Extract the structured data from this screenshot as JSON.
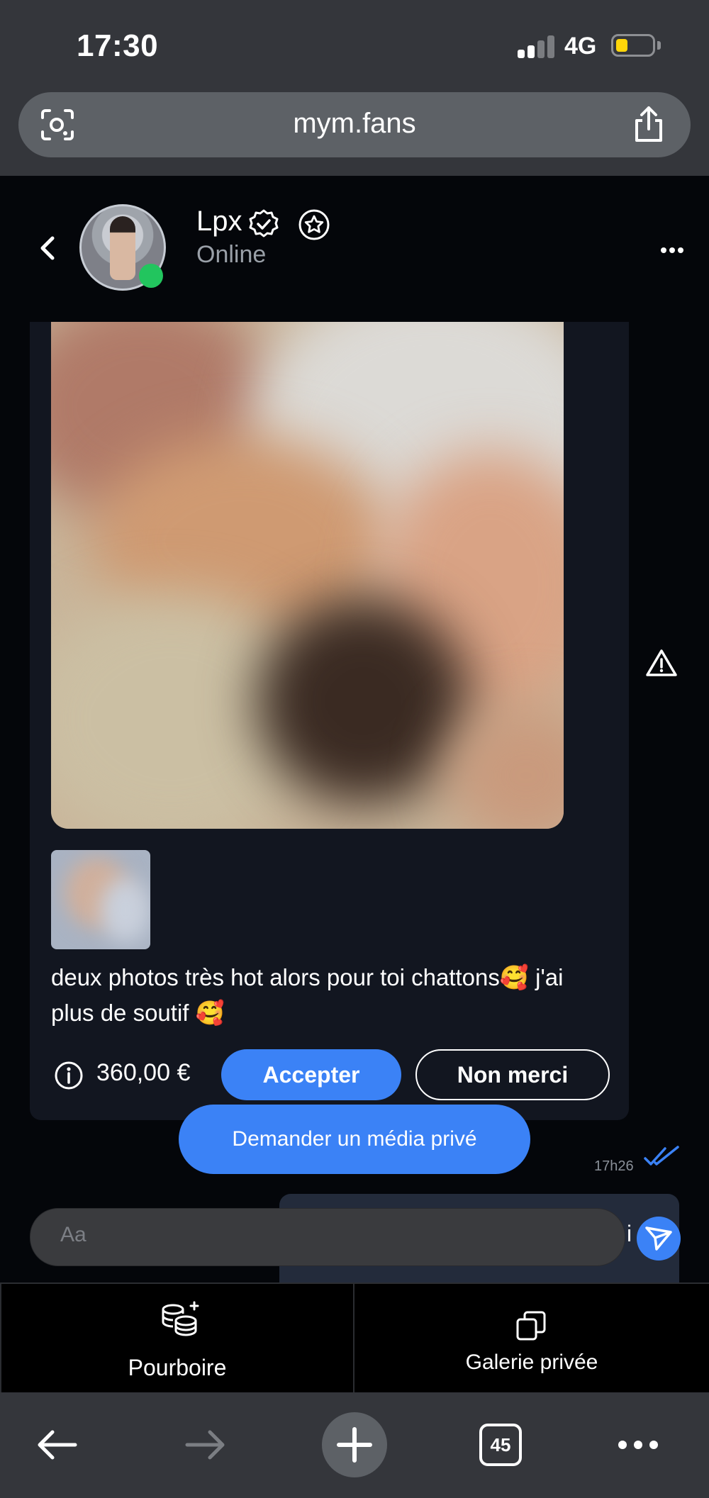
{
  "status_bar": {
    "time": "17:30",
    "network": "4G"
  },
  "browser": {
    "url": "mym.fans",
    "open_tabs": "45"
  },
  "chat_header": {
    "name": "Lpx",
    "status": "Online"
  },
  "offer": {
    "message": "deux photos très hot alors pour toi chattons🥰 j'ai plus de soutif 🥰",
    "price": "360,00 €",
    "accept_label": "Accepter",
    "decline_label": "Non merci"
  },
  "request_media_label": "Demander un média privé",
  "timestamp": "17h26",
  "sent_fragment": "i",
  "composer": {
    "placeholder": "Aa"
  },
  "actions": {
    "tip_label": "Pourboire",
    "gallery_label": "Galerie privée"
  },
  "colors": {
    "accent": "#3b82f6",
    "online": "#22c55e",
    "battery": "#ffd60a"
  }
}
